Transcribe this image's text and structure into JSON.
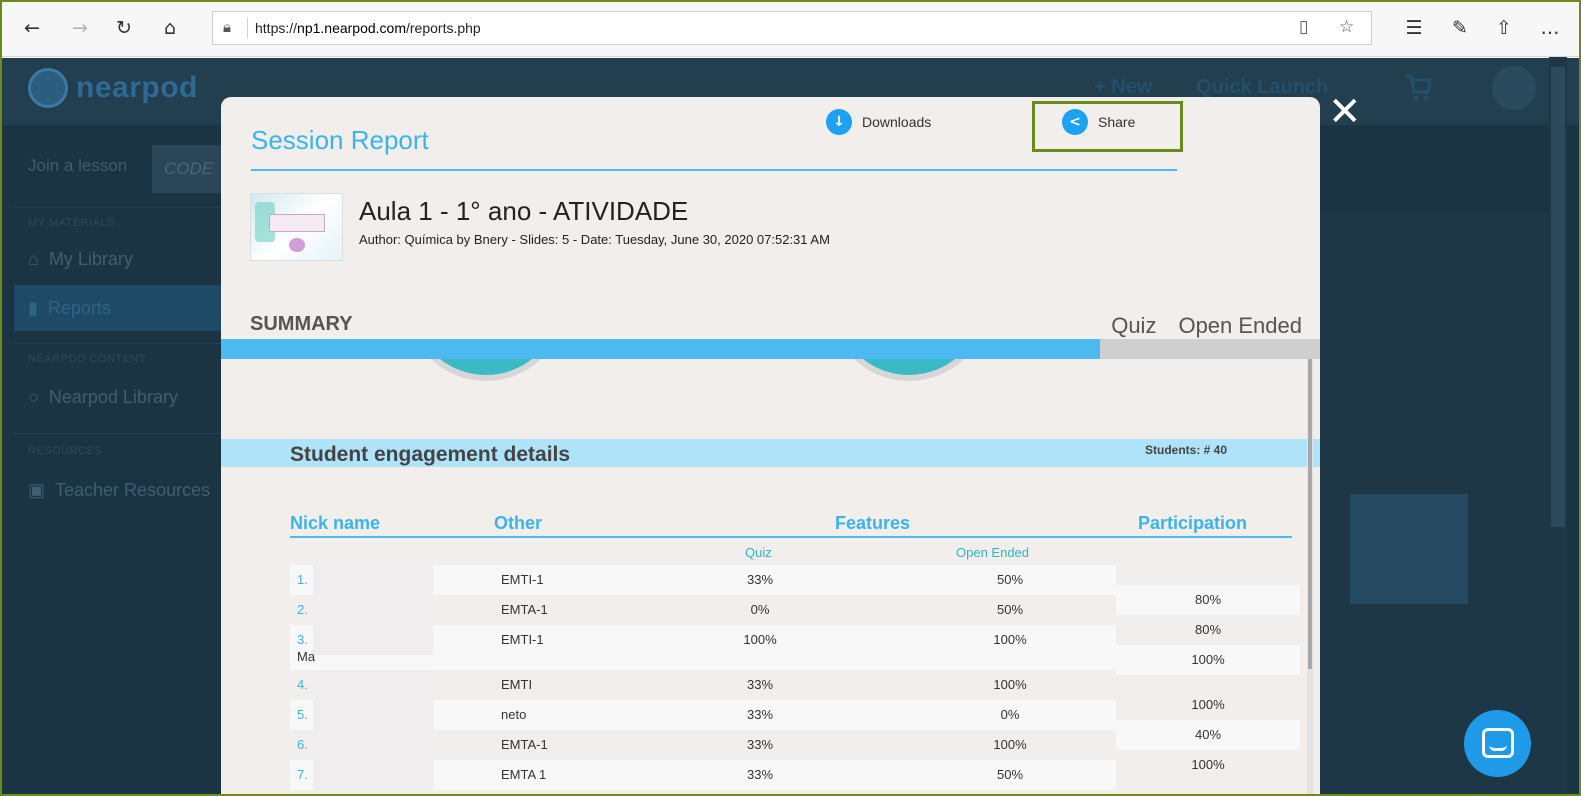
{
  "browser": {
    "url_prefix": "https://",
    "url_host": "np1.nearpod.com",
    "url_path": "/reports.php"
  },
  "app": {
    "logo_text": "nearpod",
    "new_label": "+ New",
    "quick_launch_label": "Quick Launch",
    "join_label": "Join a lesson",
    "code_placeholder": "CODE",
    "sections": {
      "materials": "MY MATERIALS",
      "content": "NEARPOD CONTENT",
      "resources": "RESOURCES"
    },
    "sidebar": [
      {
        "label": "My Library",
        "icon": "home-icon"
      },
      {
        "label": "Reports",
        "icon": "bar-chart-icon"
      },
      {
        "label": "Nearpod Library",
        "icon": "search-icon"
      },
      {
        "label": "Teacher Resources",
        "icon": "book-icon"
      }
    ]
  },
  "modal": {
    "title": "Session Report",
    "downloads_label": "Downloads",
    "share_label": "Share",
    "lesson_title": "Aula 1 - 1° ano - ATIVIDADE",
    "lesson_meta": "Author: Química by Bnery - Slides: 5 - Date: Tuesday, June 30, 2020 07:52:31 AM",
    "summary_label": "SUMMARY",
    "tabs": [
      "Quiz",
      "Open Ended"
    ],
    "progress_fraction": 0.8,
    "engagement_title": "Student engagement details",
    "students_count": "Students: # 40",
    "columns": {
      "nick": "Nick name",
      "other": "Other",
      "features": "Features",
      "participation": "Participation",
      "quiz": "Quiz",
      "open": "Open Ended"
    },
    "rows": [
      {
        "num": "1.",
        "other": "EMTI-1",
        "quiz": "33%",
        "open": "50%"
      },
      {
        "num": "2.",
        "other": "EMTA-1",
        "quiz": "0%",
        "open": "50%"
      },
      {
        "num": "3.",
        "other": "EMTI-1",
        "quiz": "100%",
        "open": "100%",
        "extra": "Ma"
      },
      {
        "num": "4.",
        "other": "EMTI",
        "quiz": "33%",
        "open": "100%"
      },
      {
        "num": "5.",
        "other": "neto",
        "quiz": "33%",
        "open": "0%"
      },
      {
        "num": "6.",
        "other": "EMTA-1",
        "quiz": "33%",
        "open": "100%"
      },
      {
        "num": "7.",
        "other": "EMTA 1",
        "quiz": "33%",
        "open": "50%"
      }
    ],
    "participation": [
      "80%",
      "80%",
      "100%",
      "100%",
      "40%",
      "100%"
    ]
  },
  "colors": {
    "accent": "#3bb4ea",
    "highlight_box": "#6a8a1a",
    "teal": "#2bb6c4"
  }
}
